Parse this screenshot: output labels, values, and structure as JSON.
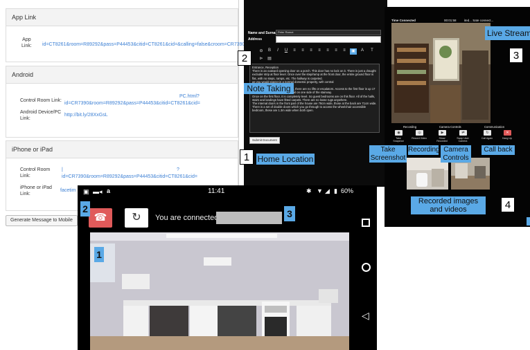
{
  "config": {
    "app_link": {
      "heading": "App Link",
      "label": "App\nLink:",
      "url": "id=CT8261&room=R89292&pass=P44453&citid=CT8261&cid=&calling=false&croom=CR7390"
    },
    "android": {
      "heading": "Android",
      "control_room_label": "Control Room Link:",
      "control_room_url_1": "PC.html?",
      "control_room_url_2": "id=CR7390&room=R89292&pass=P44453&citid=CT8261&cid=",
      "device_label": "Android Device/PC\nLink:",
      "device_url": "http://bit.ly/28XxGsL"
    },
    "iphone": {
      "heading": "iPhone or iPad",
      "control_room_label": "Control Room\nLink:",
      "control_room_url_1": "?",
      "control_room_url_2": "id=CR7390&room=R89292&pass=P44453&citid=CT8261&cid=",
      "device_label": "iPhone or iPad\nLink:",
      "device_url": "facetim"
    },
    "generate_button": "Generate Message to Mobile"
  },
  "form": {
    "name_label": "Name and Surname",
    "name_value": "Peter Ramot",
    "address_label": "Address",
    "toolbar": [
      "⊖",
      "B",
      "I",
      "U",
      "≡",
      "≡",
      "≡",
      "≡",
      "≡",
      "≡",
      "≡",
      "▣",
      "A",
      "T"
    ],
    "toolbar_row2": [
      "⊳",
      "▤"
    ],
    "notes": "Entrance, Reception\nThere is an outward opening door on a porch. This door has no lock on it. There is just a draught excluder strip at floor level. Once over the step/ramp at the front door, the entire ground floor is flat, with no steps, ramps, etc. The hallway is carpeted.\nas you would expect in a normal domestic property, with central\n\nAs this is an Edwardian property, there are no lifts or escalators. Access to the first floor is up 17 carpeted steps, there is a handrail on one side of the stairway.\nOnce on the first floor, it is completely level. So guest bedrooms are on this floor. All of the halls, stairs and landings have fitted carpets. There are no loose rugs anywhere.\nThe internal doors in the front part of the house are 78cm wide, those at the back are 71cm wide. There is a set of double doors which you go through to access the wheelchair accessible bedroom, these are 1.3m wide when both open.",
    "submit_label": "Submit Document"
  },
  "stream": {
    "time_connected_label": "Time Connected",
    "time_value": "00:01:58",
    "status_text": "ited... Sate connect...",
    "recording_heading": "Recording",
    "camera_heading": "Camera Controls",
    "communication_heading": "Communication",
    "controls": [
      {
        "icon": "camera-icon",
        "glyph": "◉",
        "label": "Take Snapshot"
      },
      {
        "icon": "record-icon",
        "glyph": "◎",
        "label": "Record Video"
      },
      {
        "icon": "video-icon",
        "glyph": "▶",
        "label": "Show Recorded"
      },
      {
        "icon": "swap-camera-icon",
        "glyph": "⇄",
        "label": "Swap User Camera"
      },
      {
        "icon": "call-again-icon",
        "glyph": "↻",
        "label": "Call Again"
      },
      {
        "icon": "hang-up-icon",
        "glyph": "✕",
        "label": "Hang Up"
      }
    ]
  },
  "annotations": {
    "live_stream": "Live Stream",
    "note_taking": "Note Taking",
    "home_location": "Home Location",
    "take_screenshot": "Take\nScreenshot",
    "recording": "Recording",
    "camera_controls": "Camera\nControls",
    "call_back": "Call back",
    "recorded_media": "Recorded images\nand videos",
    "n1": "1",
    "n2": "2",
    "n3": "3",
    "n4": "4"
  },
  "phone": {
    "time": "11:41",
    "battery": "60%",
    "connected_text": "You are connected...",
    "badge_2": "2",
    "badge_3": "3",
    "badge_1": "1"
  },
  "colors": {
    "callout": "#5aa9e6",
    "link": "#3b7fd4",
    "hangup": "#e05a5a"
  }
}
